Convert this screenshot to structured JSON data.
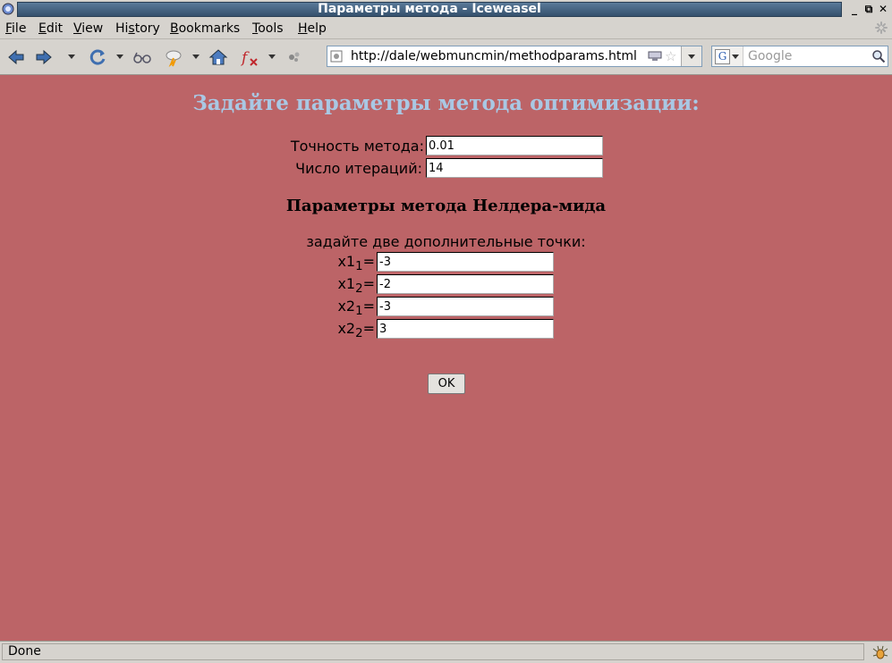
{
  "window": {
    "title": "Параметры метода - Iceweasel"
  },
  "menu": {
    "items": [
      {
        "label_u": "F",
        "label_rest": "ile"
      },
      {
        "label_u": "E",
        "label_rest": "dit"
      },
      {
        "label_u": "V",
        "label_rest": "iew"
      },
      {
        "label_pre": "Hi",
        "label_u": "s",
        "label_rest": "tory"
      },
      {
        "label_u": "B",
        "label_rest": "ookmarks"
      },
      {
        "label_u": "T",
        "label_rest": "ools"
      },
      {
        "label_u": "H",
        "label_rest": "elp"
      }
    ]
  },
  "toolbar": {
    "url": "http://dale/webmuncmin/methodparams.html",
    "search_placeholder": "Google",
    "search_engine_letter": "G"
  },
  "page": {
    "title": "Задайте параметры метода оптимизации:",
    "fields": {
      "accuracy": {
        "label": "Точность метода:",
        "value": "0.01"
      },
      "iterations": {
        "label": "Число итераций:",
        "value": "14"
      }
    },
    "subtitle": "Параметры метода Нелдера-мида",
    "hint": "задайте две дополнительные точки:",
    "points": [
      {
        "base": "x1",
        "sub": "1",
        "eq": "=",
        "value": "-3"
      },
      {
        "base": "x1",
        "sub": "2",
        "eq": "=",
        "value": "-2"
      },
      {
        "base": "x2",
        "sub": "1",
        "eq": "=",
        "value": "-3"
      },
      {
        "base": "x2",
        "sub": "2",
        "eq": "=",
        "value": "3"
      }
    ],
    "ok_label": "OK"
  },
  "status": {
    "text": "Done"
  },
  "colors": {
    "page_background": "#bc6467",
    "title_color": "#a9c8e4",
    "chrome": "#d6d3ce"
  }
}
